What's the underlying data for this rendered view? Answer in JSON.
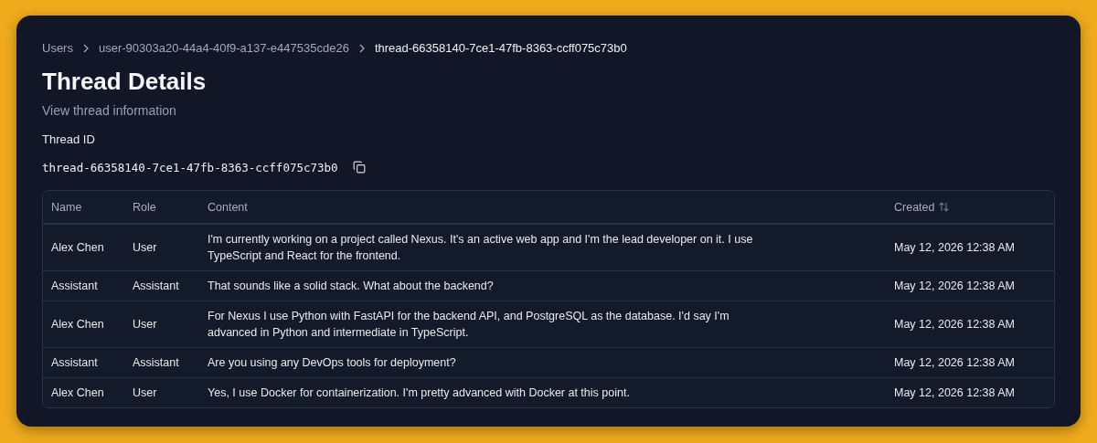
{
  "breadcrumbs": [
    {
      "label": "Users",
      "current": false
    },
    {
      "label": "user-90303a20-44a4-40f9-a137-e447535cde26",
      "current": false
    },
    {
      "label": "thread-66358140-7ce1-47fb-8363-ccff075c73b0",
      "current": true
    }
  ],
  "title": "Thread Details",
  "subtitle": "View thread information",
  "field": {
    "label": "Thread ID",
    "value": "thread-66358140-7ce1-47fb-8363-ccff075c73b0"
  },
  "table": {
    "columns": [
      {
        "label": "Name",
        "sortable": false
      },
      {
        "label": "Role",
        "sortable": false
      },
      {
        "label": "Content",
        "sortable": false
      },
      {
        "label": "Created",
        "sortable": true
      }
    ],
    "rows": [
      {
        "name": "Alex Chen",
        "role": "User",
        "content": "I'm currently working on a project called Nexus. It's an active web app and I'm the lead developer on it. I use TypeScript and React for the frontend.",
        "created": "May 12, 2026 12:38 AM"
      },
      {
        "name": "Assistant",
        "role": "Assistant",
        "content": "That sounds like a solid stack. What about the backend?",
        "created": "May 12, 2026 12:38 AM"
      },
      {
        "name": "Alex Chen",
        "role": "User",
        "content": "For Nexus I use Python with FastAPI for the backend API, and PostgreSQL as the database. I'd say I'm advanced in Python and intermediate in TypeScript.",
        "created": "May 12, 2026 12:38 AM"
      },
      {
        "name": "Assistant",
        "role": "Assistant",
        "content": "Are you using any DevOps tools for deployment?",
        "created": "May 12, 2026 12:38 AM"
      },
      {
        "name": "Alex Chen",
        "role": "User",
        "content": "Yes, I use Docker for containerization. I'm pretty advanced with Docker at this point.",
        "created": "May 12, 2026 12:38 AM"
      }
    ]
  }
}
